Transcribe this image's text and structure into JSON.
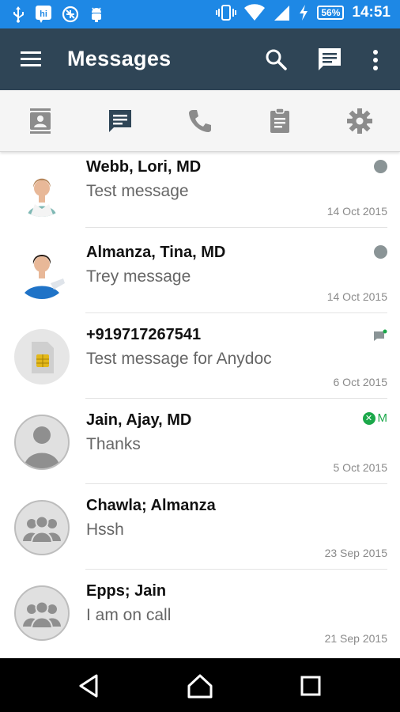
{
  "status_bar": {
    "time": "14:51",
    "battery": "56%",
    "icons_left": [
      "usb-icon",
      "hi-app-icon",
      "no-sync-icon",
      "android-debug-icon"
    ],
    "icons_right": [
      "vibrate-icon",
      "wifi-icon",
      "signal-icon",
      "charging-icon"
    ]
  },
  "app_bar": {
    "title": "Messages",
    "menu_icon": "hamburger-menu-icon",
    "search_icon": "search-icon",
    "compose_icon": "message-icon",
    "more_icon": "more-vert-icon",
    "color": "#2f4556"
  },
  "tabs": [
    {
      "id": "contacts",
      "icon": "contacts-icon",
      "active": false
    },
    {
      "id": "messages",
      "icon": "message-icon",
      "active": true
    },
    {
      "id": "calls",
      "icon": "phone-icon",
      "active": false
    },
    {
      "id": "tasks",
      "icon": "clipboard-icon",
      "active": false
    },
    {
      "id": "settings",
      "icon": "gear-icon",
      "active": false
    }
  ],
  "conversations": [
    {
      "name": "Webb, Lori, MD",
      "preview": "Test message",
      "date": "14 Oct 2015",
      "avatar": "doctor-female-avatar",
      "indicator": "grey-dot"
    },
    {
      "name": "Almanza, Tina, MD",
      "preview": "Trey message",
      "date": "14 Oct 2015",
      "avatar": "nurse-avatar",
      "indicator": "grey-dot"
    },
    {
      "name": "+919717267541",
      "preview": "Test message for Anydoc",
      "date": "6 Oct 2015",
      "avatar": "sim-card-avatar",
      "indicator": "sms-icon"
    },
    {
      "name": "Jain, Ajay, MD",
      "preview": "Thanks",
      "date": "5 Oct 2015",
      "avatar": "person-avatar",
      "indicator": "m-badge",
      "indicator_text": "M"
    },
    {
      "name": "Chawla; Almanza",
      "preview": "Hssh",
      "date": "23 Sep 2015",
      "avatar": "group-avatar",
      "indicator": "none"
    },
    {
      "name": "Epps; Jain",
      "preview": "I am on call",
      "date": "21 Sep 2015",
      "avatar": "group-avatar",
      "indicator": "none"
    }
  ],
  "nav_bar": {
    "back_icon": "back-icon",
    "home_icon": "home-icon",
    "recents_icon": "recents-icon"
  }
}
